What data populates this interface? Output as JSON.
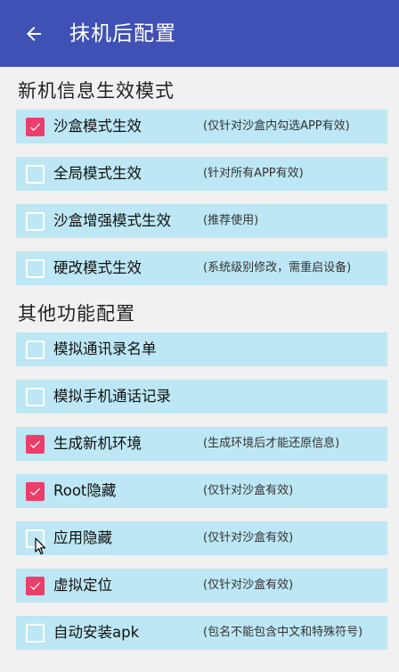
{
  "appbar": {
    "title": "抹机后配置",
    "back_icon": "arrow-left-icon"
  },
  "sections": [
    {
      "title": "新机信息生效模式",
      "items": [
        {
          "label": "沙盒模式生效",
          "hint": "(仅针对沙盒内勾选APP有效)",
          "checked": true
        },
        {
          "label": "全局模式生效",
          "hint": "(针对所有APP有效)",
          "checked": false
        },
        {
          "label": "沙盒增强模式生效",
          "hint": "(推荐使用)",
          "checked": false
        },
        {
          "label": "硬改模式生效",
          "hint": "(系统级别修改，需重启设备)",
          "checked": false
        }
      ]
    },
    {
      "title": "其他功能配置",
      "items": [
        {
          "label": "模拟通讯录名单",
          "hint": "",
          "checked": false
        },
        {
          "label": "模拟手机通话记录",
          "hint": "",
          "checked": false
        },
        {
          "label": "生成新机环境",
          "hint": "(生成环境后才能还原信息)",
          "checked": true
        },
        {
          "label": "Root隐藏",
          "hint": "(仅针对沙盒有效)",
          "checked": true
        },
        {
          "label": "应用隐藏",
          "hint": "(仅针对沙盒有效)",
          "checked": false
        },
        {
          "label": "虚拟定位",
          "hint": "(仅针对沙盒有效)",
          "checked": true
        },
        {
          "label": "自动安装apk",
          "hint": "(包名不能包含中文和特殊符号)",
          "checked": false
        }
      ]
    }
  ],
  "colors": {
    "appbar": "#3f51b5",
    "item_bg": "#bde7f4",
    "checkbox_checked": "#ec3e6b",
    "background": "#f1f1f1"
  }
}
